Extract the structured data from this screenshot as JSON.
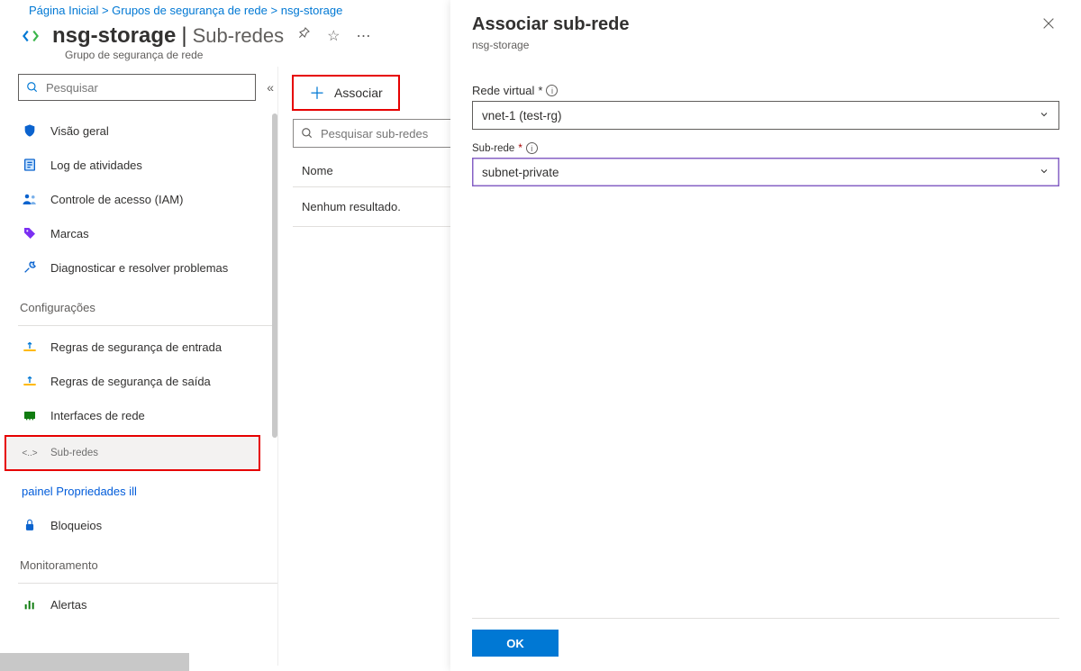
{
  "breadcrumb": {
    "home": "Página Inicial",
    "sep1": " > ",
    "group": "Grupos de segurança de rede",
    "sep2": " > ",
    "resource": "nsg-storage"
  },
  "header": {
    "title": "nsg-storage",
    "section_sep": "|",
    "section": "Sub-redes",
    "subtitle": "Grupo de segurança de rede"
  },
  "sidebar": {
    "search_placeholder": "Pesquisar",
    "items": {
      "overview": "Visão geral",
      "activity": "Log de atividades",
      "iam": "Controle de acesso (IAM)",
      "tags": "Marcas",
      "diag": "Diagnosticar e resolver problemas"
    },
    "section_settings": "Configurações",
    "settings": {
      "inbound": "Regras de segurança de entrada",
      "outbound": "Regras de segurança de saída",
      "nics": "Interfaces de rede",
      "subnets_prefix": "<..>",
      "subnets": "Sub-redes",
      "props": "painel Propriedades ill",
      "locks": "Bloqueios"
    },
    "section_monitoring": "Monitoramento",
    "monitoring": {
      "alerts": "Alertas"
    }
  },
  "main": {
    "associate_btn": "Associar",
    "search_placeholder": "Pesquisar sub-redes",
    "col_name": "Nome",
    "empty": "Nenhum resultado."
  },
  "blade": {
    "title": "Associar sub-rede",
    "subtitle": "nsg-storage",
    "vnet_label": "Rede virtual",
    "vnet_value": "vnet-1 (test-rg)",
    "subnet_label": "Sub-rede",
    "subnet_value": "subnet-private",
    "ok": "OK"
  },
  "bottom_placeholder": ""
}
